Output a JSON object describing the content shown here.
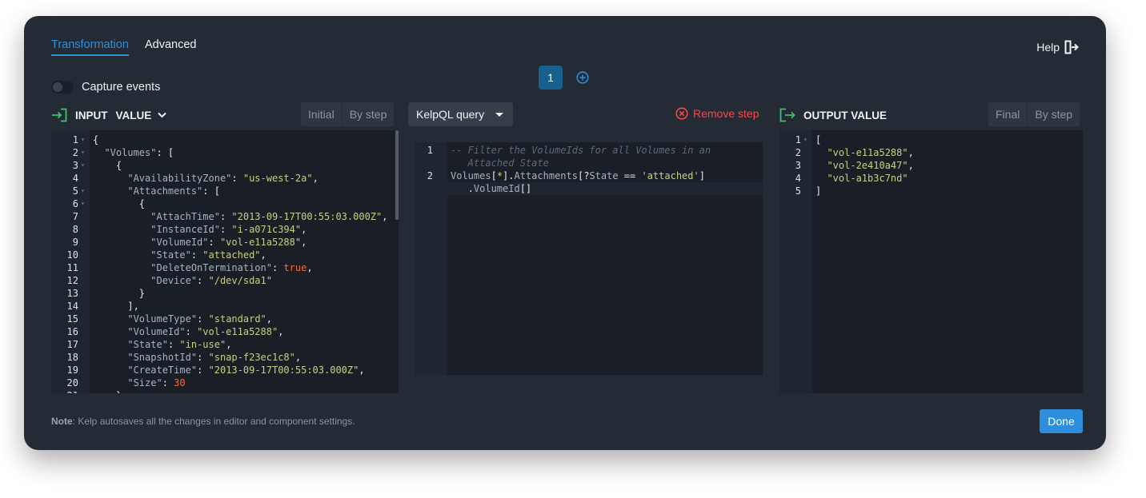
{
  "tabs": {
    "transformation": "Transformation",
    "advanced": "Advanced"
  },
  "help": {
    "label": "Help"
  },
  "capture_events": {
    "label": "Capture events",
    "enabled": false
  },
  "steps": {
    "current": "1"
  },
  "input": {
    "label_input": "INPUT",
    "label_value": "VALUE",
    "modes": [
      "Initial",
      "By step"
    ],
    "lines": [
      [
        [
          "p",
          "{"
        ]
      ],
      [
        [
          "p",
          "  "
        ],
        [
          "k",
          "\"Volumes\""
        ],
        [
          "p",
          ": ["
        ]
      ],
      [
        [
          "p",
          "    {"
        ]
      ],
      [
        [
          "p",
          "      "
        ],
        [
          "k",
          "\"AvailabilityZone\""
        ],
        [
          "p",
          ": "
        ],
        [
          "s",
          "\"us-west-2a\""
        ],
        [
          "p",
          ","
        ]
      ],
      [
        [
          "p",
          "      "
        ],
        [
          "k",
          "\"Attachments\""
        ],
        [
          "p",
          ": ["
        ]
      ],
      [
        [
          "p",
          "        {"
        ]
      ],
      [
        [
          "p",
          "          "
        ],
        [
          "k",
          "\"AttachTime\""
        ],
        [
          "p",
          ": "
        ],
        [
          "s",
          "\"2013-09-17T00:55:03.000Z\""
        ],
        [
          "p",
          ","
        ]
      ],
      [
        [
          "p",
          "          "
        ],
        [
          "k",
          "\"InstanceId\""
        ],
        [
          "p",
          ": "
        ],
        [
          "s",
          "\"i-a071c394\""
        ],
        [
          "p",
          ","
        ]
      ],
      [
        [
          "p",
          "          "
        ],
        [
          "k",
          "\"VolumeId\""
        ],
        [
          "p",
          ": "
        ],
        [
          "s",
          "\"vol-e11a5288\""
        ],
        [
          "p",
          ","
        ]
      ],
      [
        [
          "p",
          "          "
        ],
        [
          "k",
          "\"State\""
        ],
        [
          "p",
          ": "
        ],
        [
          "s",
          "\"attached\""
        ],
        [
          "p",
          ","
        ]
      ],
      [
        [
          "p",
          "          "
        ],
        [
          "k",
          "\"DeleteOnTermination\""
        ],
        [
          "p",
          ": "
        ],
        [
          "n",
          "true"
        ],
        [
          "p",
          ","
        ]
      ],
      [
        [
          "p",
          "          "
        ],
        [
          "k",
          "\"Device\""
        ],
        [
          "p",
          ": "
        ],
        [
          "s",
          "\"/dev/sda1\""
        ]
      ],
      [
        [
          "p",
          "        }"
        ]
      ],
      [
        [
          "p",
          "      ],"
        ]
      ],
      [
        [
          "p",
          "      "
        ],
        [
          "k",
          "\"VolumeType\""
        ],
        [
          "p",
          ": "
        ],
        [
          "s",
          "\"standard\""
        ],
        [
          "p",
          ","
        ]
      ],
      [
        [
          "p",
          "      "
        ],
        [
          "k",
          "\"VolumeId\""
        ],
        [
          "p",
          ": "
        ],
        [
          "s",
          "\"vol-e11a5288\""
        ],
        [
          "p",
          ","
        ]
      ],
      [
        [
          "p",
          "      "
        ],
        [
          "k",
          "\"State\""
        ],
        [
          "p",
          ": "
        ],
        [
          "s",
          "\"in-use\""
        ],
        [
          "p",
          ","
        ]
      ],
      [
        [
          "p",
          "      "
        ],
        [
          "k",
          "\"SnapshotId\""
        ],
        [
          "p",
          ": "
        ],
        [
          "s",
          "\"snap-f23ec1c8\""
        ],
        [
          "p",
          ","
        ]
      ],
      [
        [
          "p",
          "      "
        ],
        [
          "k",
          "\"CreateTime\""
        ],
        [
          "p",
          ": "
        ],
        [
          "s",
          "\"2013-09-17T00:55:03.000Z\""
        ],
        [
          "p",
          ","
        ]
      ],
      [
        [
          "p",
          "      "
        ],
        [
          "k",
          "\"Size\""
        ],
        [
          "p",
          ": "
        ],
        [
          "n",
          "30"
        ]
      ],
      [
        [
          "p",
          "    },"
        ]
      ]
    ],
    "folds": [
      1,
      2,
      3,
      5,
      6
    ]
  },
  "query": {
    "language": "KelpQL query",
    "remove_label": "Remove step",
    "lines": [
      {
        "num": "1",
        "parts": [
          [
            "c",
            "-- Filter the VolumeIds for all Volumes in an"
          ]
        ]
      },
      {
        "num": "",
        "parts": [
          [
            "c",
            "   Attached State"
          ]
        ]
      },
      {
        "num": "2",
        "parts": [
          [
            "k",
            "Volumes"
          ],
          [
            "p",
            "["
          ],
          [
            "s",
            "*"
          ],
          [
            "p",
            "]."
          ],
          [
            "k",
            "Attachments"
          ],
          [
            "p",
            "[?"
          ],
          [
            "k",
            "State"
          ],
          [
            "p",
            " == "
          ],
          [
            "s",
            "'attached'"
          ],
          [
            "p",
            "]"
          ]
        ]
      },
      {
        "num": "",
        "parts": [
          [
            "p",
            "   ."
          ],
          [
            "k",
            "VolumeId"
          ],
          [
            "p",
            "[]"
          ]
        ]
      }
    ]
  },
  "output": {
    "label": "OUTPUT VALUE",
    "modes": [
      "Final",
      "By step"
    ],
    "lines": [
      [
        [
          "p",
          "["
        ]
      ],
      [
        [
          "p",
          "  "
        ],
        [
          "s",
          "\"vol-e11a5288\""
        ],
        [
          "p",
          ","
        ]
      ],
      [
        [
          "p",
          "  "
        ],
        [
          "s",
          "\"vol-2e410a47\""
        ],
        [
          "p",
          ","
        ]
      ],
      [
        [
          "p",
          "  "
        ],
        [
          "s",
          "\"vol-a1b3c7nd\""
        ]
      ],
      [
        [
          "p",
          "]"
        ]
      ]
    ],
    "folds": [
      1
    ]
  },
  "footer": {
    "note_bold": "Note",
    "note_text": ": Kelp autosaves all the changes in editor and component settings.",
    "done": "Done"
  },
  "colors": {
    "accent": "#2d8fdc",
    "danger": "#f04a4a",
    "success": "#3fbf6f",
    "string": "#c7cf85",
    "key": "#a5b3c2",
    "number": "#f06a3f"
  }
}
